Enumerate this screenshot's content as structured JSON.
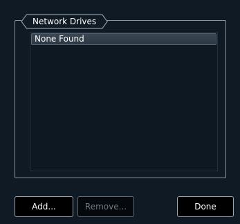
{
  "group": {
    "title": "Network Drives"
  },
  "drives_list": {
    "items": [
      "None Found"
    ]
  },
  "buttons": {
    "add": "Add...",
    "remove": "Remove...",
    "done": "Done"
  },
  "colors": {
    "background": "#0f1a24",
    "border": "#8a96a2",
    "selected_item": "#33404c",
    "button_bg": "#000000",
    "disabled_text": "#6f7a85"
  }
}
